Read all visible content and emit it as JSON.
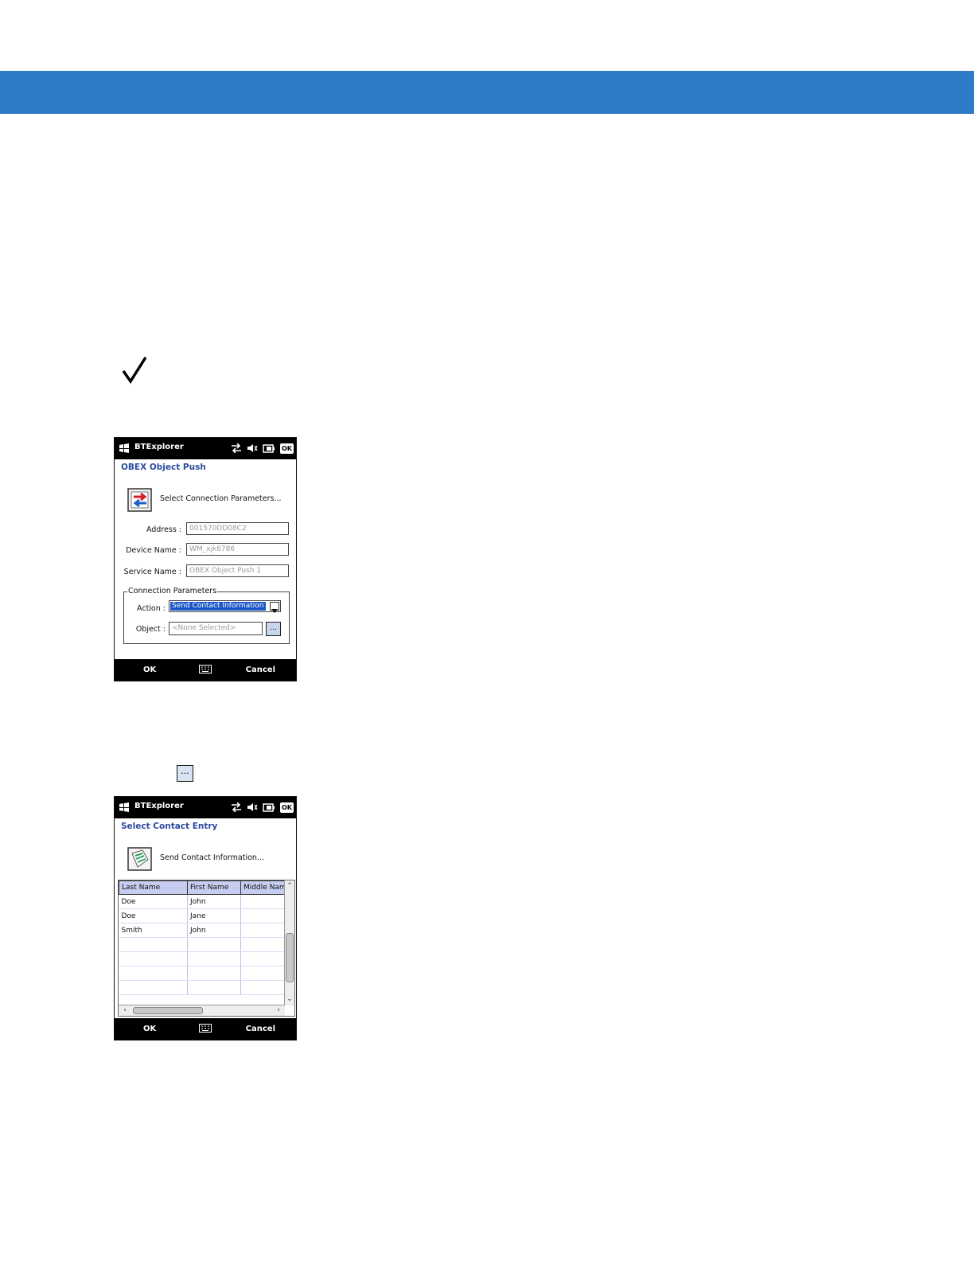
{
  "screens": [
    {
      "app_title": "BTExplorer",
      "ok_label": "OK",
      "title": "OBEX Object Push",
      "hint": "Select Connection Parameters...",
      "fields": {
        "address_label": "Address :",
        "address_value": "001570DD08C2",
        "device_label": "Device Name :",
        "device_value": "WM_xjk6786",
        "service_label": "Service Name :",
        "service_value": "OBEX Object Push 1"
      },
      "group_label": "Connection Parameters",
      "action_label": "Action :",
      "action_value": "Send Contact Information",
      "object_label": "Object :",
      "object_value": "<None Selected>",
      "browse_label": "...",
      "softkeys": {
        "left": "OK",
        "right": "Cancel"
      }
    },
    {
      "app_title": "BTExplorer",
      "ok_label": "OK",
      "title": "Select Contact Entry",
      "hint": "Send Contact Information...",
      "columns": [
        "Last Name",
        "First Name",
        "Middle Nam"
      ],
      "rows": [
        [
          "Doe",
          "John",
          ""
        ],
        [
          "Doe",
          "Jane",
          ""
        ],
        [
          "Smith",
          "John",
          ""
        ]
      ],
      "softkeys": {
        "left": "OK",
        "right": "Cancel"
      }
    }
  ],
  "inline_button_label": "...",
  "colors": {
    "header_bar": "#2e7bc8",
    "title_blue": "#2d4ba0",
    "selection": "#1c57c9"
  },
  "icons": [
    "check-icon",
    "windows-flag-icon",
    "connectivity-icon",
    "volume-muted-icon",
    "battery-icon",
    "keyboard-icon",
    "obex-transfer-icon",
    "contact-card-icon"
  ]
}
